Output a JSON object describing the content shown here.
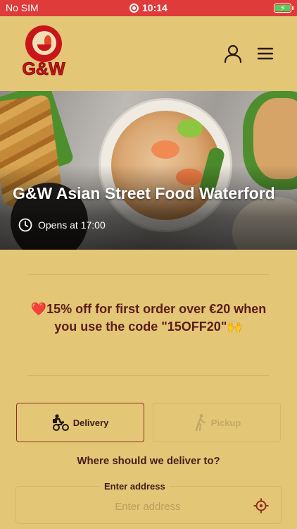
{
  "status_bar": {
    "carrier": "No SIM",
    "time": "10:14"
  },
  "header": {
    "logo_text": "G&W",
    "icons": [
      "user-icon",
      "hamburger-menu-icon"
    ]
  },
  "hero": {
    "title": "G&W Asian Street Food Waterford",
    "hours": "Opens at 17:00"
  },
  "promo": {
    "heart": "❤️",
    "text": "15% off for first order over €20 when you use the code \"15OFF20\"",
    "emoji": "🙌"
  },
  "order_type": {
    "delivery_label": "Delivery",
    "pickup_label": "Pickup",
    "selected": "Delivery"
  },
  "delivery": {
    "question": "Where should we deliver to?",
    "address_label": "Enter address",
    "address_placeholder": "Enter address",
    "address_value": ""
  },
  "colors": {
    "status_bar": "#de3b3a",
    "background": "#e3c676",
    "accent": "#8d2f21",
    "brand_red": "#c9151a"
  }
}
